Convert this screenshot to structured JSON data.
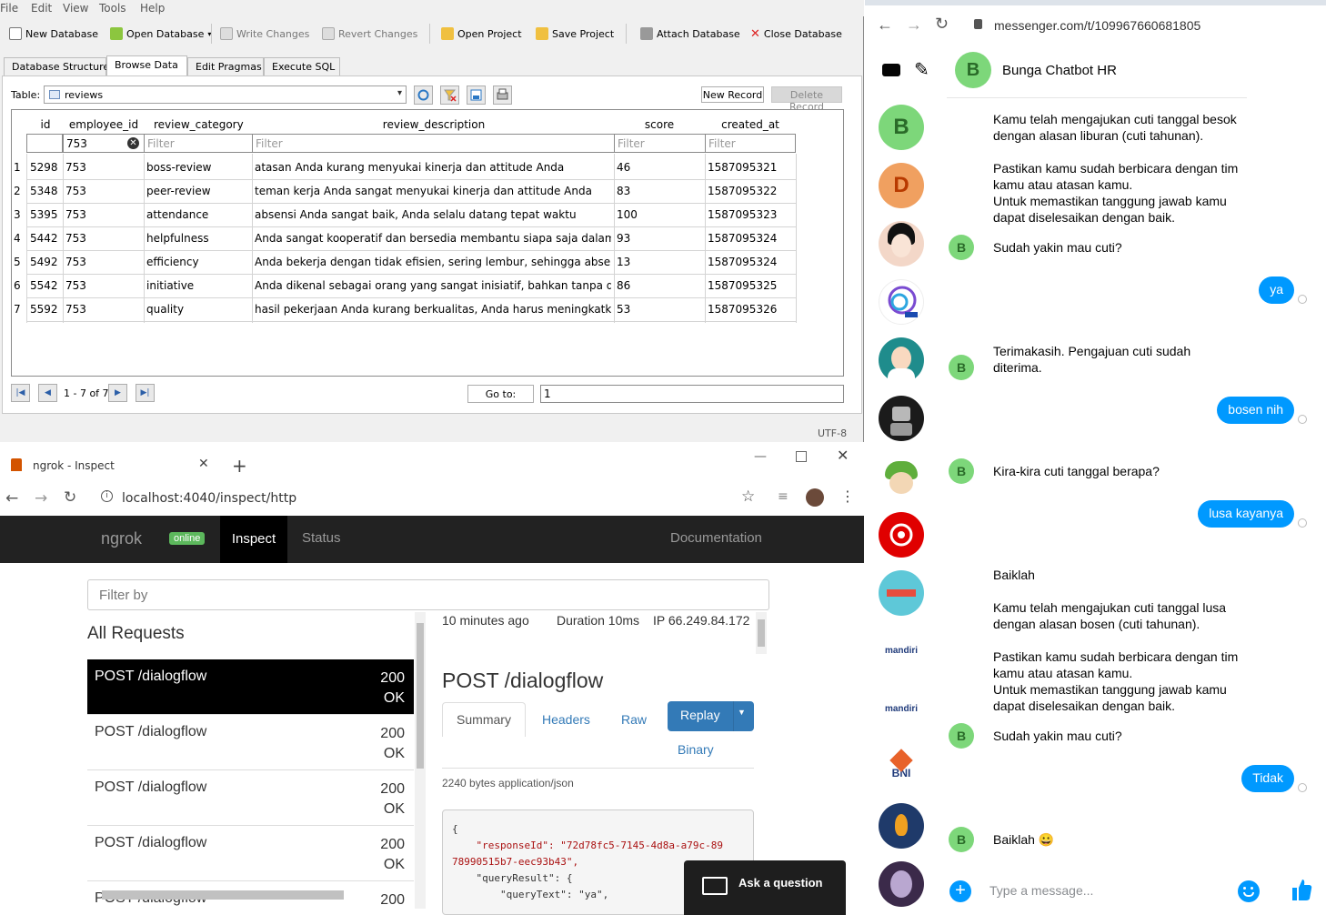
{
  "db": {
    "menu": [
      "File",
      "Edit",
      "View",
      "Tools",
      "Help"
    ],
    "toolbar": {
      "new_db": "New Database",
      "open_db": "Open Database",
      "write": "Write Changes",
      "revert": "Revert Changes",
      "open_proj": "Open Project",
      "save_proj": "Save Project",
      "attach": "Attach Database",
      "close": "Close Database"
    },
    "tabs": [
      "Database Structure",
      "Browse Data",
      "Edit Pragmas",
      "Execute SQL"
    ],
    "table_label": "Table:",
    "table_value": "reviews",
    "new_record": "New Record",
    "delete_record": "Delete Record",
    "columns": [
      "id",
      "employee_id",
      "review_category",
      "review_description",
      "score",
      "created_at"
    ],
    "filters": {
      "employee_id": "753",
      "placeholder": "Filter"
    },
    "rows": [
      [
        "1",
        "5298",
        "753",
        "boss-review",
        "atasan Anda kurang menyukai kinerja dan attitude Anda",
        "46",
        "1587095321"
      ],
      [
        "2",
        "5348",
        "753",
        "peer-review",
        "teman kerja Anda sangat menyukai kinerja dan attitude Anda",
        "83",
        "1587095322"
      ],
      [
        "3",
        "5395",
        "753",
        "attendance",
        "absensi Anda sangat baik, Anda selalu datang tepat waktu",
        "100",
        "1587095323"
      ],
      [
        "4",
        "5442",
        "753",
        "helpfulness",
        "Anda sangat kooperatif dan bersedia membantu siapa saja dalam...",
        "93",
        "1587095324"
      ],
      [
        "5",
        "5492",
        "753",
        "efficiency",
        "Anda bekerja dengan tidak efisien, sering lembur, sehingga absen...",
        "13",
        "1587095324"
      ],
      [
        "6",
        "5542",
        "753",
        "initiative",
        "Anda dikenal sebagai orang yang sangat inisiatif, bahkan tanpa di...",
        "86",
        "1587095325"
      ],
      [
        "7",
        "5592",
        "753",
        "quality",
        "hasil pekerjaan Anda kurang berkualitas, Anda harus meningkatka...",
        "53",
        "1587095326"
      ]
    ],
    "page_info": "1 - 7 of 7",
    "goto_label": "Go to:",
    "goto_value": "1",
    "encoding": "UTF-8"
  },
  "chrome": {
    "tab_title": "ngrok - Inspect",
    "url": "localhost:4040/inspect/http",
    "nav": {
      "brand": "ngrok",
      "status": "online",
      "inspect": "Inspect",
      "status_link": "Status",
      "docs": "Documentation"
    },
    "filter_placeholder": "Filter by",
    "all_requests": "All Requests",
    "requests": [
      {
        "method": "POST /dialogflow",
        "code": "200",
        "text": "OK"
      },
      {
        "method": "POST /dialogflow",
        "code": "200",
        "text": "OK"
      },
      {
        "method": "POST /dialogflow",
        "code": "200",
        "text": "OK"
      },
      {
        "method": "POST /dialogflow",
        "code": "200",
        "text": "OK"
      },
      {
        "method": "POST /dialogflow",
        "code": "200",
        "text": ""
      }
    ],
    "detail": {
      "time_ago": "10 minutes ago",
      "duration": "Duration  10ms",
      "ip": "IP  66.249.84.172",
      "title": "POST /dialogflow",
      "tab_summary": "Summary",
      "tab_headers": "Headers",
      "tab_raw": "Raw",
      "tab_binary": "Binary",
      "replay": "Replay",
      "size": "2240 bytes application/json",
      "json_lines": [
        "{",
        "    \"responseId\": \"72d78fc5-7145-4d8a-a79c-89",
        "78990515b7-eec93b43\",",
        "    \"queryResult\": {",
        "        \"queryText\": \"ya\","
      ]
    },
    "ask": "Ask a question"
  },
  "messenger": {
    "url": "messenger.com/t/109967660681805",
    "chat_name": "Bunga Chatbot HR",
    "avatar_letter": "B",
    "input_placeholder": "Type a message...",
    "colors": {
      "accent": "#0099ff",
      "bot_avatar": "#7dd77a"
    },
    "messages": [
      {
        "side": "bot",
        "text": "Kamu telah mengajukan cuti tanggal besok dengan alasan liburan (cuti tahunan).\n\nPastikan kamu sudah berbicara dengan tim kamu atau atasan kamu.\nUntuk memastikan tanggung jawab kamu dapat diselesaikan dengan baik."
      },
      {
        "side": "bot",
        "text": "Sudah yakin mau cuti?"
      },
      {
        "side": "user",
        "text": "ya"
      },
      {
        "side": "bot",
        "text": "Terimakasih. Pengajuan cuti sudah diterima."
      },
      {
        "side": "user",
        "text": "bosen nih"
      },
      {
        "side": "bot",
        "text": "Kira-kira cuti tanggal berapa?"
      },
      {
        "side": "user",
        "text": "lusa kayanya"
      },
      {
        "side": "bot",
        "text": "Baiklah\n\nKamu telah mengajukan cuti tanggal lusa dengan alasan bosen (cuti tahunan).\n\nPastikan kamu sudah berbicara dengan tim kamu atau atasan kamu.\nUntuk memastikan tanggung jawab kamu dapat diselesaikan dengan baik."
      },
      {
        "side": "bot",
        "text": "Sudah yakin mau cuti?"
      },
      {
        "side": "user",
        "text": "Tidak"
      },
      {
        "side": "bot",
        "text": "Baiklah 😀"
      }
    ],
    "sidebar_labels": [
      "B",
      "D",
      "mandiri",
      "mandiri",
      "BNI"
    ]
  }
}
